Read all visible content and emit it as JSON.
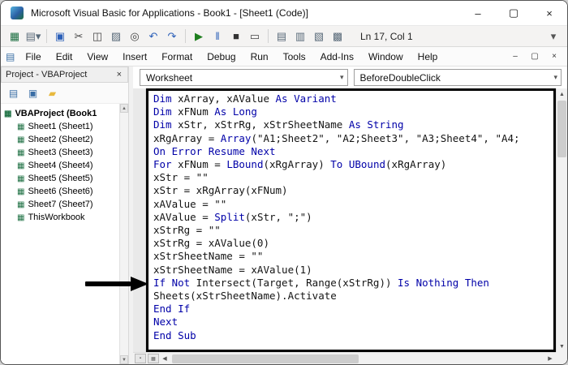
{
  "window": {
    "title": "Microsoft Visual Basic for Applications - Book1 - [Sheet1 (Code)]",
    "controls": {
      "minimize": "–",
      "maximize": "▢",
      "close": "×"
    }
  },
  "toolbar": {
    "position_label": "Ln 17, Col 1",
    "icons": [
      {
        "name": "excel-view-icon",
        "glyph": "▦",
        "color": "#1d6f42"
      },
      {
        "name": "insert-userform-icon",
        "glyph": "▤▾",
        "color": "#5a6b7a"
      },
      {
        "name": "separator"
      },
      {
        "name": "save-icon",
        "glyph": "▣",
        "color": "#2b5fb8"
      },
      {
        "name": "cut-icon",
        "glyph": "✂",
        "color": "#444444"
      },
      {
        "name": "copy-icon",
        "glyph": "◫",
        "color": "#444444"
      },
      {
        "name": "paste-icon",
        "glyph": "▨",
        "color": "#5a6b7a"
      },
      {
        "name": "find-icon",
        "glyph": "◎",
        "color": "#444444"
      },
      {
        "name": "undo-icon",
        "glyph": "↶",
        "color": "#2b5fb8"
      },
      {
        "name": "redo-icon",
        "glyph": "↷",
        "color": "#2b5fb8"
      },
      {
        "name": "separator"
      },
      {
        "name": "run-icon",
        "glyph": "▶",
        "color": "#1e7e1e"
      },
      {
        "name": "break-icon",
        "glyph": "‖",
        "color": "#2b5fb8"
      },
      {
        "name": "reset-icon",
        "glyph": "■",
        "color": "#333333"
      },
      {
        "name": "design-mode-icon",
        "glyph": "▭",
        "color": "#444444"
      },
      {
        "name": "separator"
      },
      {
        "name": "project-explorer-icon",
        "glyph": "▤",
        "color": "#5a6b7a"
      },
      {
        "name": "properties-window-icon",
        "glyph": "▥",
        "color": "#5a6b7a"
      },
      {
        "name": "object-browser-icon",
        "glyph": "▧",
        "color": "#5a6b7a"
      },
      {
        "name": "toolbox-icon",
        "glyph": "▩",
        "color": "#5a6b7a"
      }
    ],
    "overflow_icon": {
      "name": "toolbar-options-icon",
      "glyph": "▾"
    }
  },
  "menu_bar": {
    "items": [
      "File",
      "Edit",
      "View",
      "Insert",
      "Format",
      "Debug",
      "Run",
      "Tools",
      "Add-Ins",
      "Window",
      "Help"
    ],
    "child_controls": {
      "minimize": "–",
      "restore": "▢",
      "close": "×"
    }
  },
  "project_panel": {
    "title": "Project - VBAProject",
    "close_glyph": "×",
    "tools": [
      {
        "name": "view-code-icon",
        "glyph": "▤",
        "color": "#3a6ea5"
      },
      {
        "name": "view-object-icon",
        "glyph": "▣",
        "color": "#3a6ea5"
      },
      {
        "name": "toggle-folders-icon",
        "glyph": "▰",
        "color": "#e8b93e"
      }
    ],
    "icons": {
      "sheet-icon": {
        "glyph": "▦",
        "color": "#1d6f42"
      },
      "workbook-icon": {
        "glyph": "▦",
        "color": "#217346"
      }
    },
    "root": {
      "label": "VBAProject (Book1",
      "icon": "workbook-icon"
    },
    "items": [
      {
        "label": "Sheet1 (Sheet1)",
        "icon": "sheet-icon"
      },
      {
        "label": "Sheet2 (Sheet2)",
        "icon": "sheet-icon"
      },
      {
        "label": "Sheet3 (Sheet3)",
        "icon": "sheet-icon"
      },
      {
        "label": "Sheet4 (Sheet4)",
        "icon": "sheet-icon"
      },
      {
        "label": "Sheet5 (Sheet5)",
        "icon": "sheet-icon"
      },
      {
        "label": "Sheet6 (Sheet6)",
        "icon": "sheet-icon"
      },
      {
        "label": "Sheet7 (Sheet7)",
        "icon": "sheet-icon"
      },
      {
        "label": "ThisWorkbook",
        "icon": "workbook-icon"
      }
    ]
  },
  "code_pane": {
    "object_selector": "Worksheet",
    "procedure_selector": "BeforeDoubleClick",
    "keyword_color": "#0000A8",
    "lines": [
      [
        [
          "k",
          "Dim"
        ],
        [
          "n",
          " xArray, xAValue "
        ],
        [
          "k",
          "As Variant"
        ]
      ],
      [
        [
          "k",
          "Dim"
        ],
        [
          "n",
          " xFNum "
        ],
        [
          "k",
          "As Long"
        ]
      ],
      [
        [
          "k",
          "Dim"
        ],
        [
          "n",
          " xStr, xStrRg, xStrSheetName "
        ],
        [
          "k",
          "As String"
        ]
      ],
      [
        [
          "n",
          "xRgArray = "
        ],
        [
          "k",
          "Array"
        ],
        [
          "n",
          "(\"A1;Sheet2\", \"A2;Sheet3\", \"A3;Sheet4\", \"A4;"
        ]
      ],
      [
        [
          "k",
          "On Error Resume Next"
        ]
      ],
      [
        [
          "k",
          "For"
        ],
        [
          "n",
          " xFNum = "
        ],
        [
          "k",
          "LBound"
        ],
        [
          "n",
          "(xRgArray) "
        ],
        [
          "k",
          "To"
        ],
        [
          "n",
          " "
        ],
        [
          "k",
          "UBound"
        ],
        [
          "n",
          "(xRgArray)"
        ]
      ],
      [
        [
          "n",
          "xStr = \"\""
        ]
      ],
      [
        [
          "n",
          "xStr = xRgArray(xFNum)"
        ]
      ],
      [
        [
          "n",
          "xAValue = \"\""
        ]
      ],
      [
        [
          "n",
          "xAValue = "
        ],
        [
          "k",
          "Split"
        ],
        [
          "n",
          "(xStr, \";\")"
        ]
      ],
      [
        [
          "n",
          "xStrRg = \"\""
        ]
      ],
      [
        [
          "n",
          "xStrRg = xAValue(0)"
        ]
      ],
      [
        [
          "n",
          "xStrSheetName = \"\""
        ]
      ],
      [
        [
          "n",
          "xStrSheetName = xAValue(1)"
        ]
      ],
      [
        [
          "k",
          "If Not"
        ],
        [
          "n",
          " Intersect(Target, Range(xStrRg)) "
        ],
        [
          "k",
          "Is Nothing Then"
        ]
      ],
      [
        [
          "n",
          "Sheets(xStrSheetName).Activate"
        ]
      ],
      [
        [
          "k",
          "End If"
        ]
      ],
      [
        [
          "k",
          "Next"
        ]
      ],
      [
        [
          "k",
          "End Sub"
        ]
      ]
    ]
  }
}
